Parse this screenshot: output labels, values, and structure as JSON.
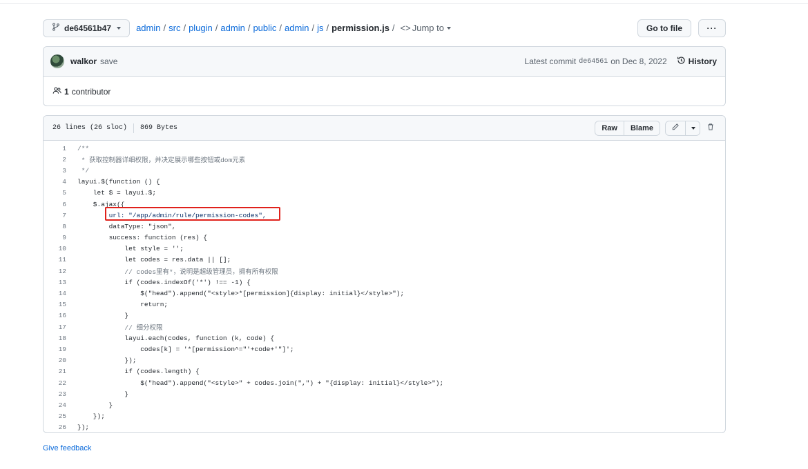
{
  "branch": {
    "name": "de64561b47"
  },
  "breadcrumb": {
    "parts": [
      "admin",
      "src",
      "plugin",
      "admin",
      "public",
      "admin",
      "js"
    ],
    "file": "permission.js",
    "jump_to": "Jump to"
  },
  "header_buttons": {
    "go_to_file": "Go to file",
    "more": "···"
  },
  "commit": {
    "author": "walkor",
    "message": "save",
    "latest_label": "Latest commit",
    "sha": "de64561",
    "date": "on Dec 8, 2022",
    "history": "History"
  },
  "contributors": {
    "count": "1",
    "label": "contributor"
  },
  "file_info": {
    "lines": "26 lines (26 sloc)",
    "size": "869 Bytes"
  },
  "file_buttons": {
    "raw": "Raw",
    "blame": "Blame"
  },
  "code": {
    "lines": [
      {
        "n": "1",
        "text": "/**"
      },
      {
        "n": "2",
        "text": " * 获取控制器详细权限，并决定展示哪些按钮或dom元素"
      },
      {
        "n": "3",
        "text": " */"
      },
      {
        "n": "4",
        "text": "layui.$(function () {"
      },
      {
        "n": "5",
        "text": "    let $ = layui.$;"
      },
      {
        "n": "6",
        "text": "    $.ajax({"
      },
      {
        "n": "7",
        "text": "        url: \"/app/admin/rule/permission-codes\","
      },
      {
        "n": "8",
        "text": "        dataType: \"json\","
      },
      {
        "n": "9",
        "text": "        success: function (res) {"
      },
      {
        "n": "10",
        "text": "            let style = '';"
      },
      {
        "n": "11",
        "text": "            let codes = res.data || [];"
      },
      {
        "n": "12",
        "text": "            // codes里有*，说明是超级管理员，拥有所有权限"
      },
      {
        "n": "13",
        "text": "            if (codes.indexOf('*') !== -1) {"
      },
      {
        "n": "14",
        "text": "                $(\"head\").append(\"<style>*[permission]{display: initial}</style>\");"
      },
      {
        "n": "15",
        "text": "                return;"
      },
      {
        "n": "16",
        "text": "            }"
      },
      {
        "n": "17",
        "text": "            // 细分权限"
      },
      {
        "n": "18",
        "text": "            layui.each(codes, function (k, code) {"
      },
      {
        "n": "19",
        "text": "                codes[k] = '*[permission^=\"'+code+'\"]';"
      },
      {
        "n": "20",
        "text": "            });"
      },
      {
        "n": "21",
        "text": "            if (codes.length) {"
      },
      {
        "n": "22",
        "text": "                $(\"head\").append(\"<style>\" + codes.join(\",\") + \"{display: initial}</style>\");"
      },
      {
        "n": "23",
        "text": "            }"
      },
      {
        "n": "24",
        "text": "        }"
      },
      {
        "n": "25",
        "text": "    });"
      },
      {
        "n": "26",
        "text": "});"
      }
    ]
  },
  "footer": {
    "feedback": "Give feedback"
  },
  "colors": {
    "link": "#0969da",
    "highlight": "#e0211b",
    "keyword": "#cf222e",
    "string": "#0a3069"
  }
}
